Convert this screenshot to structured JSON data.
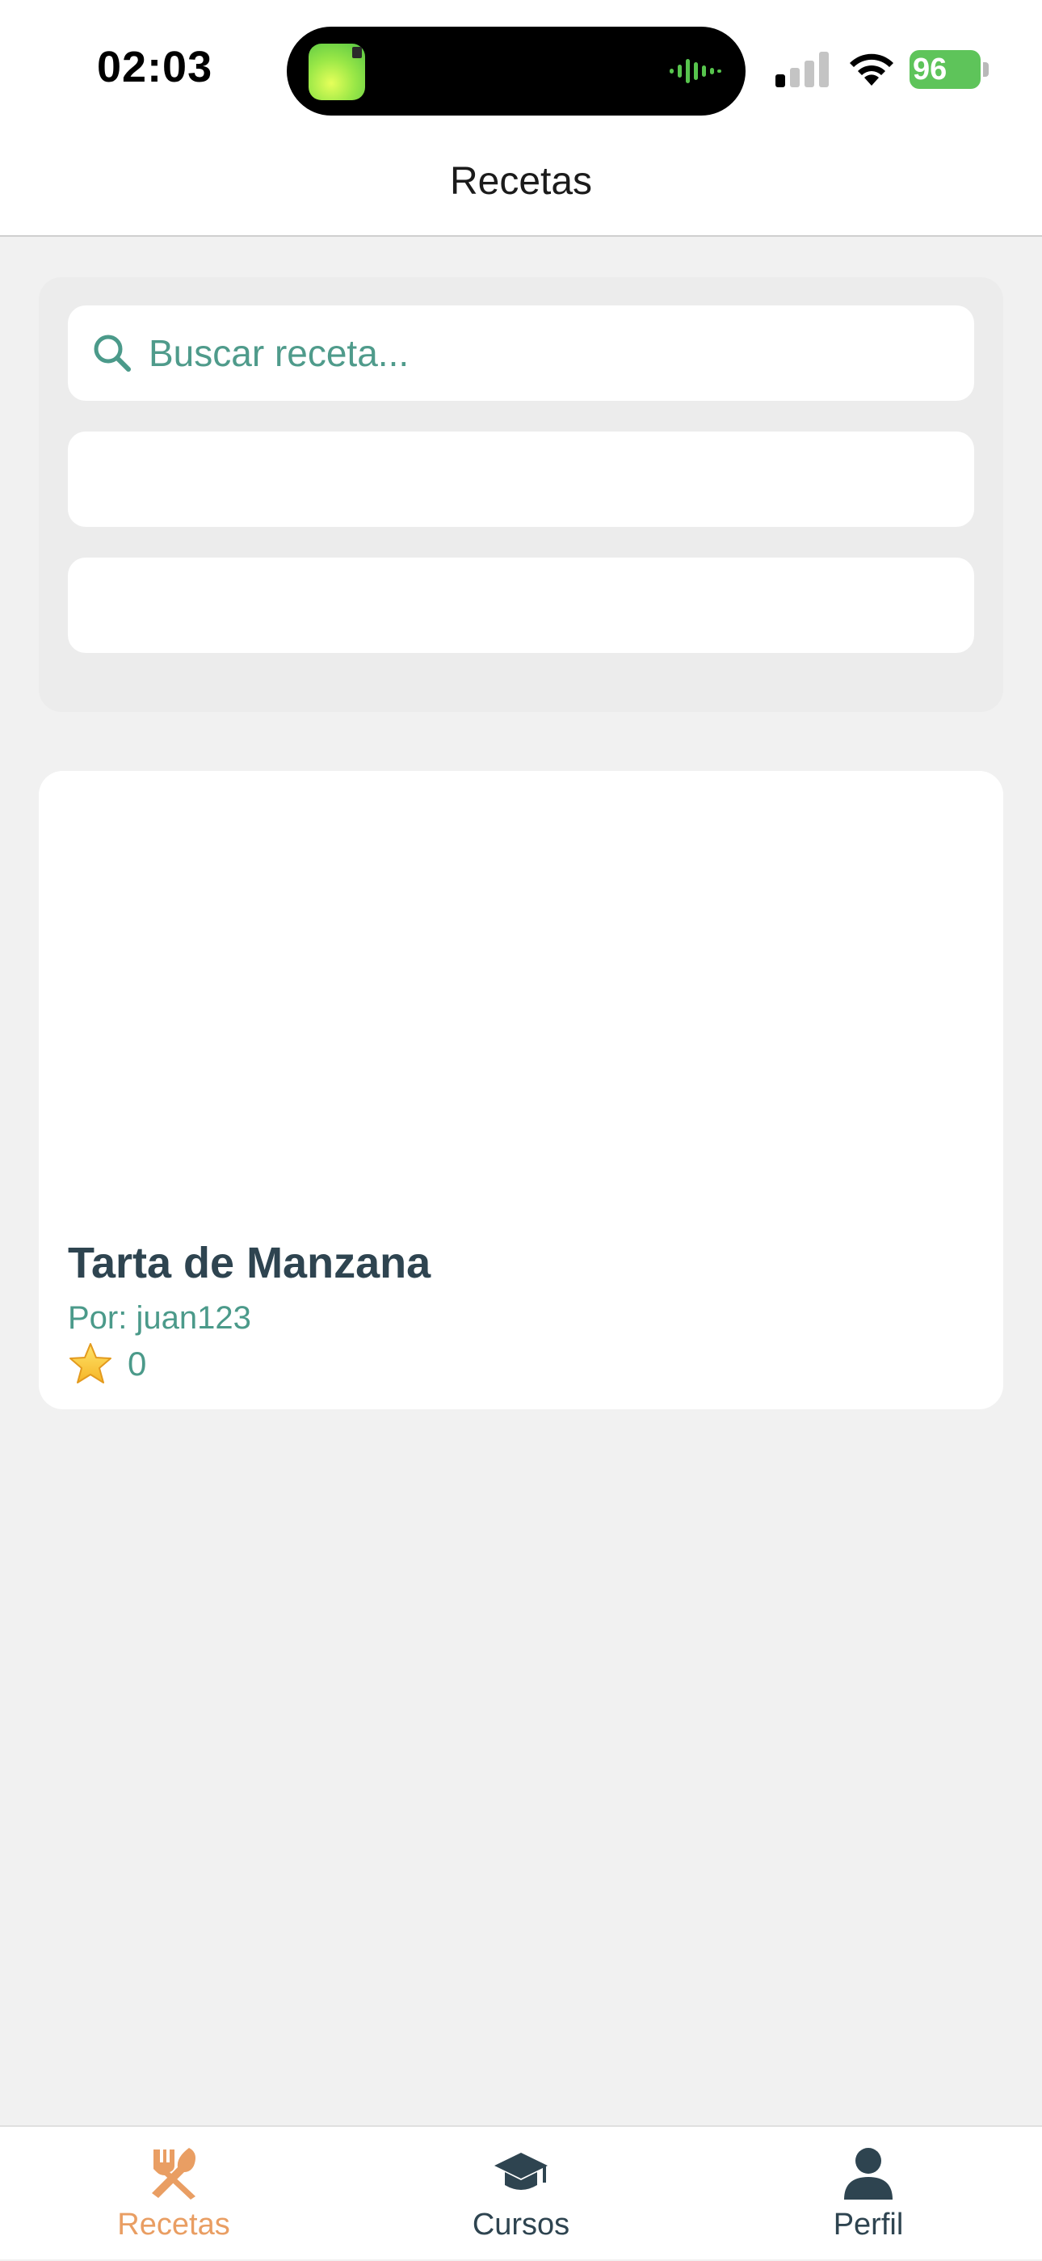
{
  "status_bar": {
    "time": "02:03",
    "battery": "96"
  },
  "header": {
    "title": "Recetas"
  },
  "search": {
    "placeholder": "Buscar receta..."
  },
  "recipes": [
    {
      "title": "Tarta de Manzana",
      "author": "Por: juan123",
      "rating": "0"
    }
  ],
  "tabs": [
    {
      "label": "Recetas",
      "icon": "utensils-icon",
      "active": true
    },
    {
      "label": "Cursos",
      "icon": "graduation-cap-icon",
      "active": false
    },
    {
      "label": "Perfil",
      "icon": "user-icon",
      "active": false
    }
  ],
  "colors": {
    "accent": "#e99e63",
    "teal": "#4b9a8a",
    "dark": "#2e4450",
    "background": "#f1f1f1"
  }
}
